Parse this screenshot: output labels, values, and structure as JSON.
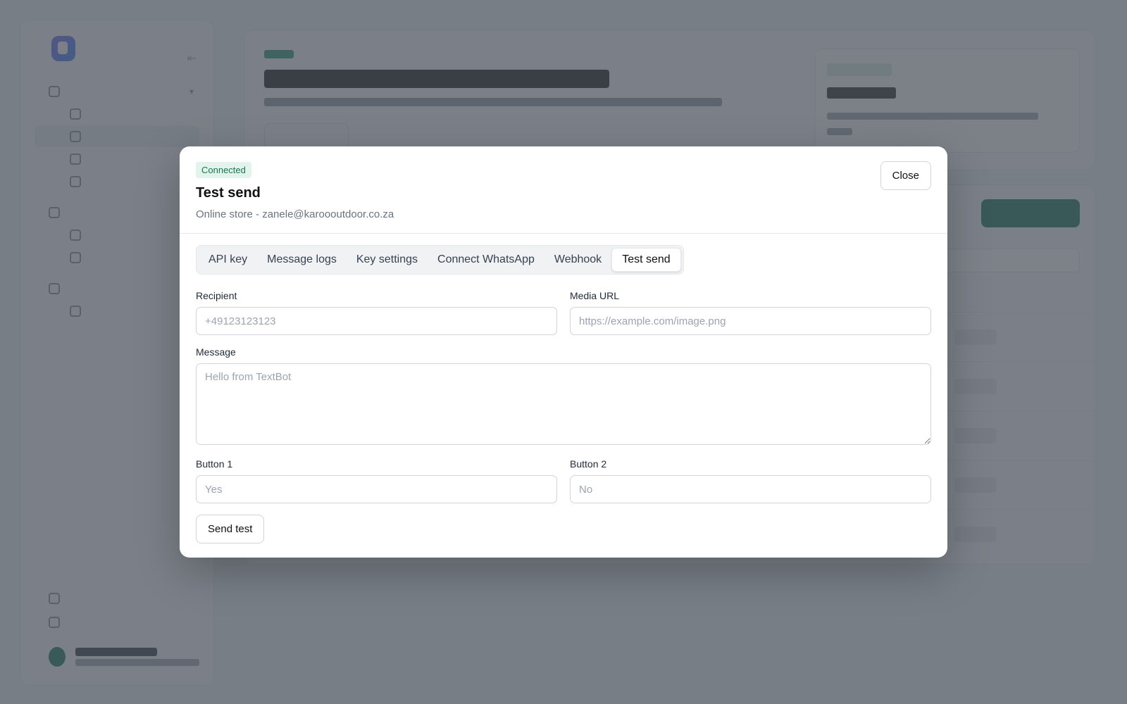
{
  "modal": {
    "badge": "Connected",
    "title": "Test send",
    "subtitle": "Online store - zanele@karoooutdoor.co.za",
    "close_label": "Close",
    "tabs": [
      {
        "label": "API key",
        "active": false
      },
      {
        "label": "Message logs",
        "active": false
      },
      {
        "label": "Key settings",
        "active": false
      },
      {
        "label": "Connect WhatsApp",
        "active": false
      },
      {
        "label": "Webhook",
        "active": false
      },
      {
        "label": "Test send",
        "active": true
      }
    ],
    "form": {
      "recipient": {
        "label": "Recipient",
        "placeholder": "+49123123123",
        "value": ""
      },
      "media_url": {
        "label": "Media URL",
        "placeholder": "https://example.com/image.png",
        "value": ""
      },
      "message": {
        "label": "Message",
        "placeholder": "Hello from TextBot",
        "value": ""
      },
      "button1": {
        "label": "Button 1",
        "placeholder": "Yes",
        "value": ""
      },
      "button2": {
        "label": "Button 2",
        "placeholder": "No",
        "value": ""
      },
      "submit_label": "Send test"
    }
  },
  "colors": {
    "accent": "#0d6b52",
    "badge_bg": "#e3f4ec",
    "badge_text": "#17764f",
    "overlay": "#4b525b"
  },
  "icons": [
    "textbot-logo-icon",
    "collapse-icon",
    "chevron-down-icon",
    "nav-icon",
    "avatar"
  ]
}
